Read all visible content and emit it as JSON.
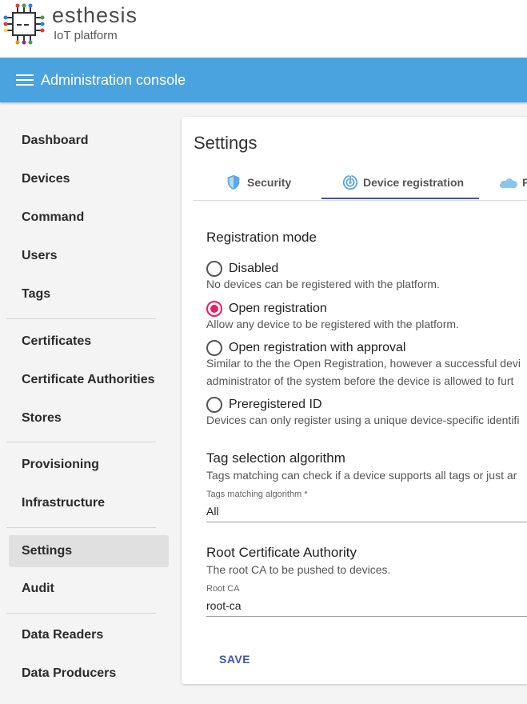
{
  "brand": {
    "name": "esthesis",
    "subtitle": "IoT platform",
    "logo_icon": "circuit-chip-icon"
  },
  "toolbar": {
    "title": "Administration console",
    "menu_icon": "hamburger-menu-icon"
  },
  "sidebar": {
    "items": [
      {
        "label": "Dashboard"
      },
      {
        "label": "Devices"
      },
      {
        "label": "Command"
      },
      {
        "label": "Users"
      },
      {
        "label": "Tags"
      },
      {
        "label": "Certificates"
      },
      {
        "label": "Certificate Authorities"
      },
      {
        "label": "Stores"
      },
      {
        "label": "Provisioning"
      },
      {
        "label": "Infrastructure"
      },
      {
        "label": "Settings",
        "active": true
      },
      {
        "label": "Audit"
      },
      {
        "label": "Data Readers"
      },
      {
        "label": "Data Producers"
      }
    ]
  },
  "settings": {
    "title": "Settings",
    "tabs": [
      {
        "label": "Security",
        "icon": "shield-icon"
      },
      {
        "label": "Device registration",
        "icon": "radar-icon",
        "active": true
      },
      {
        "label": "P",
        "icon": "cloud-icon"
      }
    ],
    "registration": {
      "title": "Registration mode",
      "options": [
        {
          "label": "Disabled",
          "hint": "No devices can be registered with the platform.",
          "selected": false
        },
        {
          "label": "Open registration",
          "hint": "Allow any device to be registered with the platform.",
          "selected": true
        },
        {
          "label": "Open registration with approval",
          "hint": "Similar to the the Open Registration, however a successful devi",
          "hint2": "administrator of the system before the device is allowed to furt",
          "selected": false
        },
        {
          "label": "Preregistered ID",
          "hint": "Devices can only register using a unique device-specific identifi",
          "selected": false
        }
      ]
    },
    "tags": {
      "title": "Tag selection algorithm",
      "hint": "Tags matching can check if a device supports all tags or just ar",
      "field_label": "Tags matching algorithm *",
      "field_value": "All"
    },
    "root_ca": {
      "title": "Root Certificate Authority",
      "hint": "The root CA to be pushed to devices.",
      "field_label": "Root CA",
      "field_value": "root-ca"
    },
    "save_label": "SAVE"
  },
  "colors": {
    "toolbar": "#4aa3df",
    "accent": "#e91e63",
    "primary": "#3f51b5"
  }
}
